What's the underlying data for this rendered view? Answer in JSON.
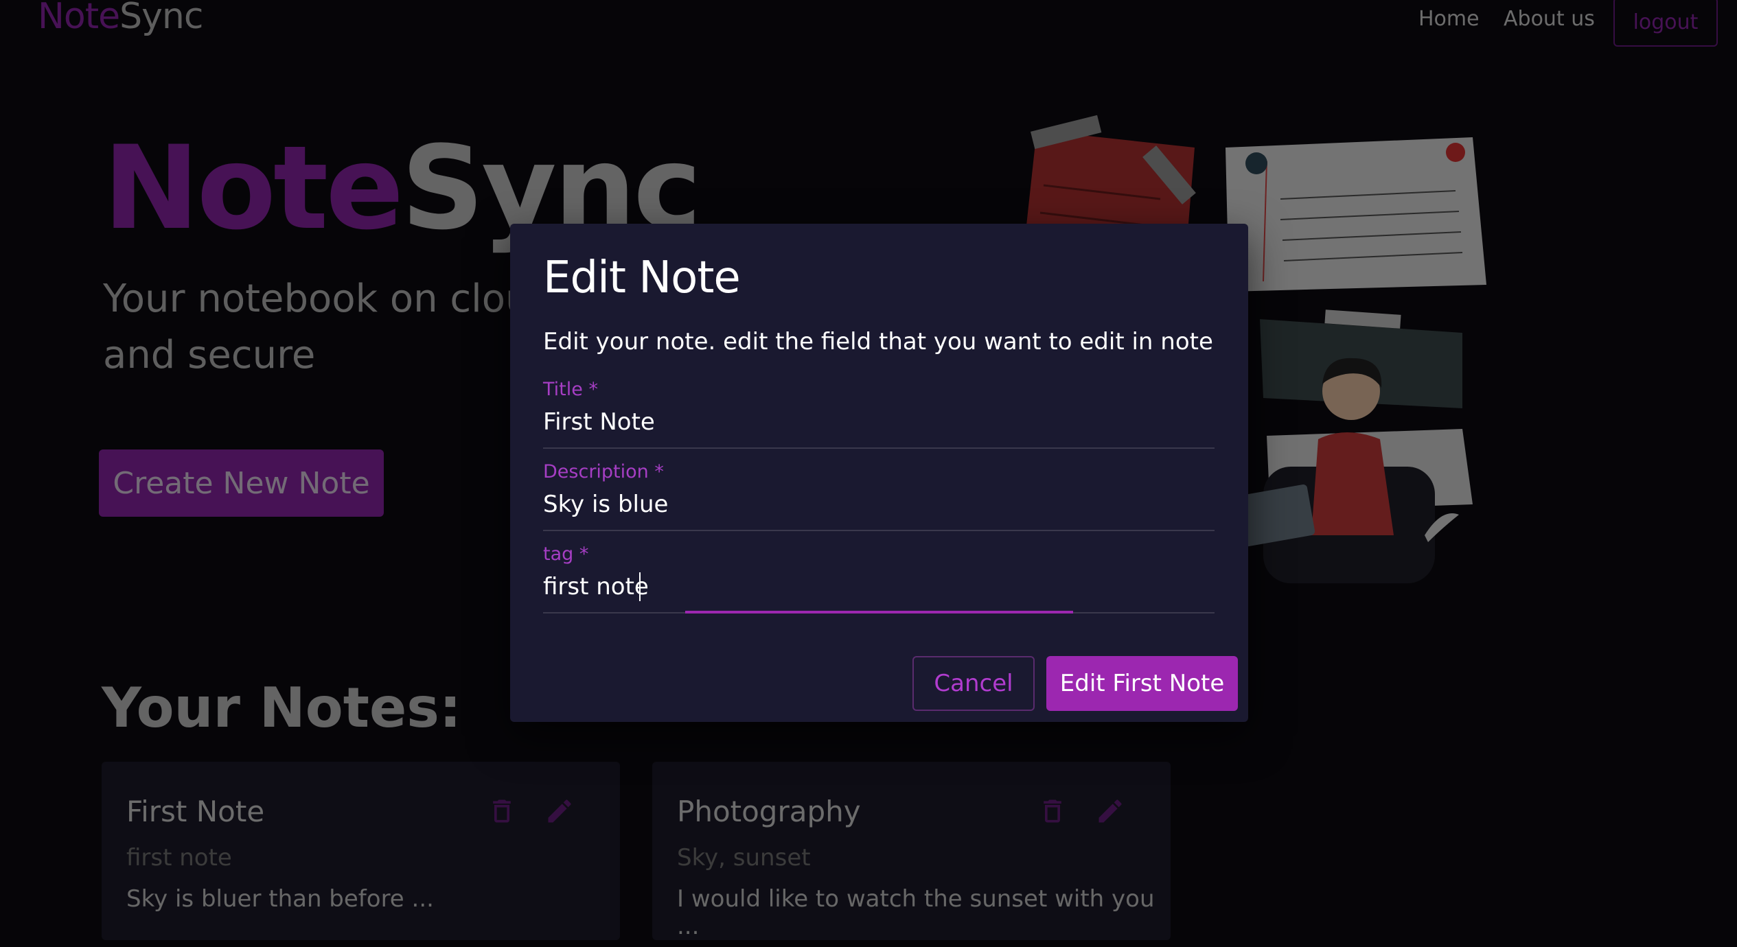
{
  "navbar": {
    "brand_note": "Note",
    "brand_sync": "Sync",
    "links": [
      {
        "label": "Home"
      },
      {
        "label": "About us"
      }
    ],
    "logout_label": "logout"
  },
  "hero": {
    "title_note": "Note",
    "title_sync": "Sync",
    "subtitle": "Your notebook on cloud - safe and secure",
    "create_button": "Create New Note"
  },
  "notes_section": {
    "heading": "Your Notes:",
    "notes": [
      {
        "title": "First Note",
        "tag": "first note",
        "description": "Sky is bluer than before ..."
      },
      {
        "title": "Photography",
        "tag": "Sky, sunset",
        "description": "I would like to watch the sunset with you ..."
      }
    ]
  },
  "dialog": {
    "title": "Edit Note",
    "text": "Edit your note. edit the field that you want to edit in note",
    "fields": [
      {
        "label": "Title *",
        "value": "First Note"
      },
      {
        "label": "Description *",
        "value": "Sky is blue"
      },
      {
        "label": "tag *",
        "value": "first note"
      }
    ],
    "cancel_label": "Cancel",
    "submit_label": "Edit First Note"
  },
  "colors": {
    "accent": "#9c27b0",
    "dialog_bg": "#1a1930",
    "page_bg": "#0c0b10"
  }
}
